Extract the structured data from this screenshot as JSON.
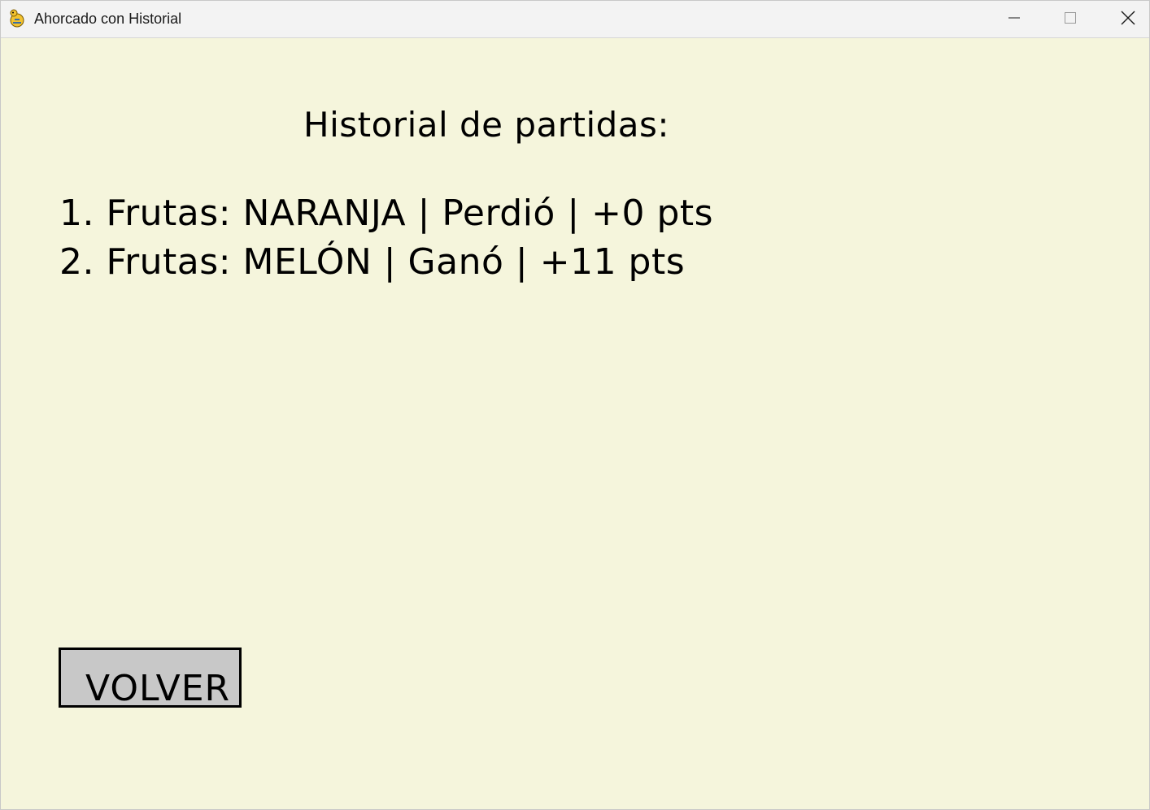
{
  "window": {
    "title": "Ahorcado con Historial",
    "icon": "pygame-snake-icon",
    "controls": {
      "minimize_icon": "minimize-icon",
      "maximize_icon": "maximize-icon",
      "close_icon": "close-icon"
    }
  },
  "screen": {
    "heading": "Historial de partidas:",
    "history": [
      "1. Frutas: NARANJA | Perdió | +0 pts",
      "2. Frutas: MELÓN | Ganó | +11 pts"
    ],
    "back_button_label": "VOLVER"
  },
  "colors": {
    "background": "#f5f5dc",
    "button_fill": "#c8c8c8",
    "button_border": "#000000",
    "text": "#000000"
  }
}
